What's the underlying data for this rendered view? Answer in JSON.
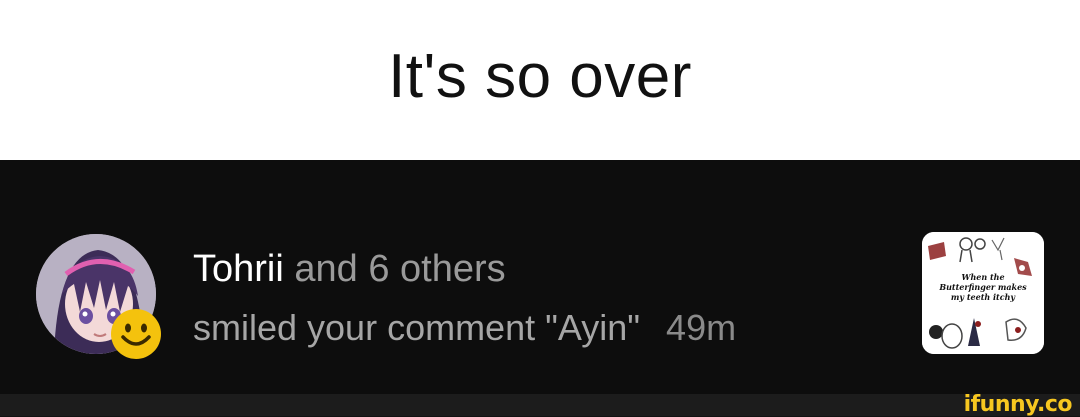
{
  "caption": {
    "text": "It's so over"
  },
  "notification": {
    "actor": "Tohrii",
    "others": " and 6 others",
    "action": "smiled your comment \"Ayin\"",
    "time": "49m",
    "avatar_icon": "anime-avatar-icon",
    "badge_icon": "smile-emoji-icon",
    "thumbnail": {
      "lines": [
        "When the",
        "Butterfinger makes",
        "my teeth itchy"
      ]
    }
  },
  "watermark": {
    "text": "ifunny.co"
  },
  "colors": {
    "caption_bg": "#ffffff",
    "notification_bg": "#0d0d0d",
    "badge": "#f4c20d",
    "watermark": "#f7c720"
  }
}
